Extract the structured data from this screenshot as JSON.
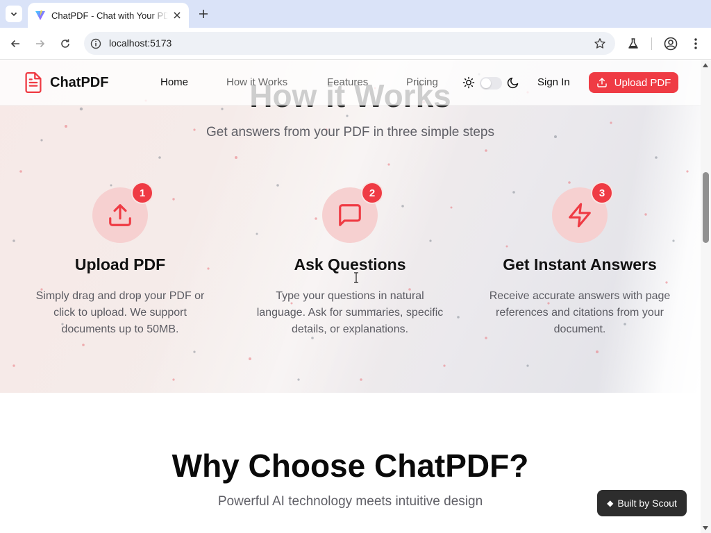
{
  "browser": {
    "tab_title": "ChatPDF - Chat with Your PDF",
    "url": "localhost:5173"
  },
  "navbar": {
    "brand": "ChatPDF",
    "links": [
      "Home",
      "How it Works",
      "Features",
      "Pricing"
    ],
    "active_link": "Home",
    "sign_in": "Sign In",
    "upload": "Upload PDF",
    "theme_toggle_on": false
  },
  "how_it_works": {
    "heading": "How it Works",
    "subtitle": "Get answers from your PDF in three simple steps",
    "steps": [
      {
        "number": "1",
        "icon": "upload-icon",
        "title": "Upload PDF",
        "description": "Simply drag and drop your PDF or click to upload. We support documents up to 50MB."
      },
      {
        "number": "2",
        "icon": "message-square-icon",
        "title": "Ask Questions",
        "description": "Type your questions in natural language. Ask for summaries, specific details, or explanations."
      },
      {
        "number": "3",
        "icon": "zap-icon",
        "title": "Get Instant Answers",
        "description": "Receive accurate answers with page references and citations from your document."
      }
    ]
  },
  "why": {
    "heading": "Why Choose ChatPDF?",
    "subtitle": "Powerful AI technology meets intuitive design"
  },
  "badge": {
    "label": "Built by Scout"
  },
  "colors": {
    "accent": "#ef3b44",
    "accent_soft": "#f6d0d0",
    "tab_strip": "#dae3f8"
  }
}
